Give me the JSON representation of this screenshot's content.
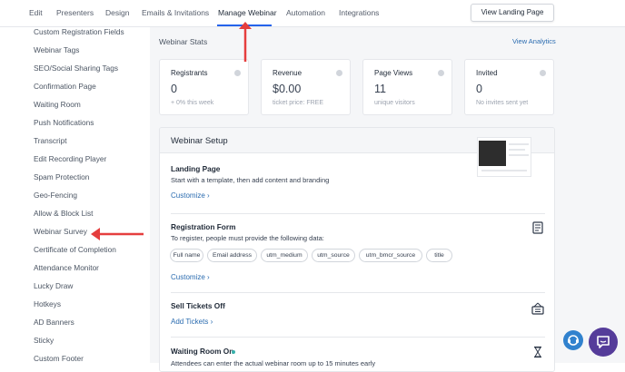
{
  "nav": {
    "tabs": [
      "Edit",
      "Presenters",
      "Design",
      "Emails & Invitations",
      "Manage Webinar",
      "Automation",
      "Integrations"
    ],
    "view_landing": "View Landing Page"
  },
  "sidebar": {
    "items": [
      "Custom Registration Fields",
      "Webinar Tags",
      "SEO/Social Sharing Tags",
      "Confirmation Page",
      "Waiting Room",
      "Push Notifications",
      "Transcript",
      "Edit Recording Player",
      "Spam Protection",
      "Geo-Fencing",
      "Allow & Block List",
      "Webinar Survey",
      "Certificate of Completion",
      "Attendance Monitor",
      "Lucky Draw",
      "Hotkeys",
      "AD Banners",
      "Sticky",
      "Custom Footer"
    ]
  },
  "stats": {
    "title": "Webinar Stats",
    "view_analytics": "View Analytics",
    "cards": [
      {
        "label": "Registrants",
        "value": "0",
        "sub": "+ 0% this week"
      },
      {
        "label": "Revenue",
        "value": "$0.00",
        "sub": "ticket price: FREE"
      },
      {
        "label": "Page Views",
        "value": "11",
        "sub": "unique visitors"
      },
      {
        "label": "Invited",
        "value": "0",
        "sub": "No invites sent yet"
      }
    ]
  },
  "setup": {
    "title": "Webinar Setup",
    "landing": {
      "title": "Landing Page",
      "desc": "Start with a template, then add content and branding",
      "link": "Customize ›"
    },
    "registration": {
      "title": "Registration Form",
      "desc": "To register, people must provide the following data:",
      "fields": [
        "Full name",
        "Email address",
        "utm_medium",
        "utm_source",
        "utm_bmcr_source",
        "title"
      ],
      "link": "Customize ›"
    },
    "tickets": {
      "title": "Sell Tickets Off",
      "link": "Add Tickets ›"
    },
    "waiting": {
      "title": "Waiting Room On",
      "desc": "Attendees can enter the actual webinar room up to 15 minutes early"
    }
  },
  "colors": {
    "accent": "#2563eb",
    "link": "#2b6cb0",
    "arrow": "#e53e3e",
    "chat_blue": "#3182ce",
    "chat_purple": "#553c9a"
  }
}
